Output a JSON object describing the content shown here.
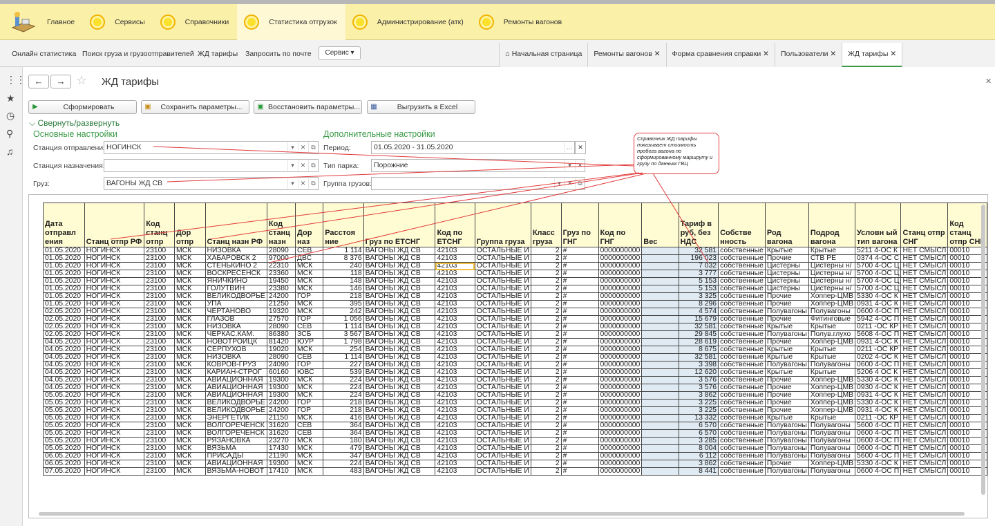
{
  "sections": [
    {
      "label": "Главное",
      "icon": "home-desk-icon"
    },
    {
      "label": "Сервисы",
      "icon": "circle-icon"
    },
    {
      "label": "Справочники",
      "icon": "circle-icon"
    },
    {
      "label": "Статистика отгрузок",
      "icon": "circle-icon"
    },
    {
      "label": "Администрирование (атк)",
      "icon": "circle-icon"
    },
    {
      "label": "Ремонты вагонов",
      "icon": "circle-icon"
    }
  ],
  "subnav": {
    "links": [
      "Онлайн статистика",
      "Поиск груза и грузоотправителей",
      "ЖД тарифы",
      "Запросить по почте"
    ],
    "service_button": "Сервис ▾"
  },
  "open_tabs": [
    {
      "label": "Начальная страница",
      "icon": "home-icon",
      "closable": false
    },
    {
      "label": "Ремонты вагонов",
      "closable": true
    },
    {
      "label": "Форма сравнения справки",
      "closable": true
    },
    {
      "label": "Пользователи",
      "closable": true
    },
    {
      "label": "ЖД тарифы",
      "closable": true
    }
  ],
  "form": {
    "title": "ЖД тарифы",
    "buttons": {
      "generate": "Сформировать",
      "save_params": "Сохранить параметры...",
      "restore_params": "Восстановить параметры...",
      "export_excel": "Выгрузить в Excel"
    },
    "collapse_label": "Свернуть/развернуть",
    "main_settings": "Основные настройки",
    "extra_settings": "Дополнительные настройки",
    "fields": {
      "departure_station": {
        "label": "Станция отправления:",
        "value": "НОГИНСК"
      },
      "destination_station": {
        "label": "Станция назначения:",
        "value": ""
      },
      "cargo": {
        "label": "Груз:",
        "value": "ВАГОНЫ ЖД СВ"
      },
      "period": {
        "label": "Период:",
        "value": "01.05.2020 - 31.05.2020"
      },
      "park_type": {
        "label": "Тип парка:",
        "value": "Порожние"
      },
      "cargo_group": {
        "label": "Группа грузов:",
        "value": ""
      }
    },
    "note": "Справочник ЖД тарифы показывает стоимость пробега вагона по сформированному маршруту и грузу по данным ГВЦ"
  },
  "table": {
    "headers": [
      "Дата отправл ения",
      "Станц отпр РФ",
      "Код станц отпр",
      "Дор отпр",
      "Станц назн РФ",
      "Код станц назн",
      "Дор наз",
      "Расстоя ние",
      "Груз по ЕТСНГ",
      "Код по ЕТСНГ",
      "Группа груза",
      "Класс груза",
      "Груз по ГНГ",
      "Код по ГНГ",
      "Вес",
      "Тариф в руб, без НДС",
      "Собстве нность",
      "Род вагона",
      "Подрод вагона",
      "Условн ый тип вагона",
      "Станц отпр СНГ",
      "Код станц отпр СНГ"
    ],
    "rows": [
      [
        "01.05.2020",
        "НОГИНСК",
        "23100",
        "МСК",
        "НИЗОВКА",
        "28090",
        "СЕВ",
        "1 114",
        "ВАГОНЫ ЖД СВ",
        "42103",
        "ОСТАЛЬНЫЕ И",
        "2",
        "#",
        "0000000000",
        "",
        "32 581",
        "собственные",
        "Крытые",
        "Крытые",
        "5211 4-ОС К",
        "НЕТ СМЫСЛ",
        "00010"
      ],
      [
        "01.05.2020",
        "НОГИНСК",
        "23100",
        "МСК",
        "ХАБАРОВСК 2",
        "97000",
        "ДВС",
        "8 376",
        "ВАГОНЫ ЖД СВ",
        "42103",
        "ОСТАЛЬНЫЕ И",
        "2",
        "#",
        "0000000000",
        "",
        "196 023",
        "собственные",
        "Прочие",
        "СТВ РЕ",
        "0374 4-ОС С",
        "НЕТ СМЫСЛ",
        "00010"
      ],
      [
        "01.05.2020",
        "НОГИНСК",
        "23100",
        "МСК",
        "СТЕНЬКИНО 2",
        "22310",
        "МСК",
        "240",
        "ВАГОНЫ ЖД СВ",
        "42103",
        "ОСТАЛЬНЫЕ И",
        "2",
        "#",
        "0000000000",
        "",
        "7 032",
        "собственные",
        "Цистерны",
        "Цистерны н/",
        "5700 4-ОС Ц",
        "НЕТ СМЫСЛ",
        "00010"
      ],
      [
        "01.05.2020",
        "НОГИНСК",
        "23100",
        "МСК",
        "ВОСКРЕСЕНСК",
        "23360",
        "МСК",
        "118",
        "ВАГОНЫ ЖД СВ",
        "42103",
        "ОСТАЛЬНЫЕ И",
        "2",
        "#",
        "0000000000",
        "",
        "3 777",
        "собственные",
        "Цистерны",
        "Цистерны н/",
        "5700 4-ОС Ц",
        "НЕТ СМЫСЛ",
        "00010"
      ],
      [
        "01.05.2020",
        "НОГИНСК",
        "23100",
        "МСК",
        "ЯНИЧКИНО",
        "19450",
        "МСК",
        "148",
        "ВАГОНЫ ЖД СВ",
        "42103",
        "ОСТАЛЬНЫЕ И",
        "2",
        "#",
        "0000000000",
        "",
        "5 153",
        "собственные",
        "Цистерны",
        "Цистерны н/",
        "5700 4-ОС Ц",
        "НЕТ СМЫСЛ",
        "00010"
      ],
      [
        "01.05.2020",
        "НОГИНСК",
        "23100",
        "МСК",
        "ГОЛУТВИН",
        "23380",
        "МСК",
        "146",
        "ВАГОНЫ ЖД СВ",
        "42103",
        "ОСТАЛЬНЫЕ И",
        "2",
        "#",
        "0000000000",
        "",
        "5 153",
        "собственные",
        "Цистерны",
        "Цистерны н/",
        "5700 4-ОС Ц",
        "НЕТ СМЫСЛ",
        "00010"
      ],
      [
        "01.05.2020",
        "НОГИНСК",
        "23100",
        "МСК",
        "ВЕЛИКОДВОРЬЕ",
        "24200",
        "ГОР",
        "218",
        "ВАГОНЫ ЖД СВ",
        "42103",
        "ОСТАЛЬНЫЕ И",
        "2",
        "#",
        "0000000000",
        "",
        "3 325",
        "собственные",
        "Прочие",
        "Хоппер-ЦМВ",
        "5330 4-ОС К",
        "НЕТ СМЫСЛ",
        "00010"
      ],
      [
        "01.05.2020",
        "НОГИНСК",
        "23100",
        "МСК",
        "УПА",
        "21250",
        "МСК",
        "395",
        "ВАГОНЫ ЖД СВ",
        "42103",
        "ОСТАЛЬНЫЕ И",
        "2",
        "#",
        "0000000000",
        "",
        "8 296",
        "собственные",
        "Прочие",
        "Хоппер-ЦМВ",
        "0931 4-ОС К",
        "НЕТ СМЫСЛ",
        "00010"
      ],
      [
        "02.05.2020",
        "НОГИНСК",
        "23100",
        "МСК",
        "ЧЕРТАНОВО",
        "19320",
        "МСК",
        "242",
        "ВАГОНЫ ЖД СВ",
        "42103",
        "ОСТАЛЬНЫЕ И",
        "2",
        "#",
        "0000000000",
        "",
        "4 574",
        "собственные",
        "Полувагоны",
        "Полувагоны",
        "0600 4-ОС П",
        "НЕТ СМЫСЛ",
        "00010"
      ],
      [
        "02.05.2020",
        "НОГИНСК",
        "23100",
        "МСК",
        "ГЛАЗОВ",
        "27570",
        "ГОР",
        "1 056",
        "ВАГОНЫ ЖД СВ",
        "42103",
        "ОСТАЛЬНЫЕ И",
        "2",
        "#",
        "0000000000",
        "",
        "15 679",
        "собственные",
        "Прочие",
        "Фитинговые",
        "5942 4-ОС П",
        "НЕТ СМЫСЛ",
        "00010"
      ],
      [
        "02.05.2020",
        "НОГИНСК",
        "23100",
        "МСК",
        "НИЗОВКА",
        "28090",
        "СЕВ",
        "1 114",
        "ВАГОНЫ ЖД СВ",
        "42103",
        "ОСТАЛЬНЫЕ И",
        "2",
        "#",
        "0000000000",
        "",
        "32 581",
        "собственные",
        "Крытые",
        "Крытые",
        "0211 -ОС КР",
        "НЕТ СМЫСЛ",
        "00010"
      ],
      [
        "02.05.2020",
        "НОГИНСК",
        "23100",
        "МСК",
        "ЧЕРКАС.КАМ.",
        "86380",
        "ЗСБ",
        "3 567",
        "ВАГОНЫ ЖД СВ",
        "42103",
        "ОСТАЛЬНЫЕ И",
        "2",
        "#",
        "0000000000",
        "",
        "29 845",
        "собственные",
        "Полувагоны",
        "Полув.глухо",
        "5608 4-ОС П",
        "НЕТ СМЫСЛ",
        "00010"
      ],
      [
        "04.05.2020",
        "НОГИНСК",
        "23100",
        "МСК",
        "НОВОТРОИЦК",
        "81420",
        "ЮУР",
        "1 798",
        "ВАГОНЫ ЖД СВ",
        "42103",
        "ОСТАЛЬНЫЕ И",
        "2",
        "#",
        "0000000000",
        "",
        "28 619",
        "собственные",
        "Прочие",
        "Хоппер-ЦМВ",
        "0931 4-ОС К",
        "НЕТ СМЫСЛ",
        "00010"
      ],
      [
        "04.05.2020",
        "НОГИНСК",
        "23100",
        "МСК",
        "СЕРПУХОВ",
        "19020",
        "МСК",
        "254",
        "ВАГОНЫ ЖД СВ",
        "42103",
        "ОСТАЛЬНЫЕ И",
        "2",
        "#",
        "0000000000",
        "",
        "8 675",
        "собственные",
        "Крытые",
        "Крытые",
        "0211 -ОС КР",
        "НЕТ СМЫСЛ",
        "00010"
      ],
      [
        "04.05.2020",
        "НОГИНСК",
        "23100",
        "МСК",
        "НИЗОВКА",
        "28090",
        "СЕВ",
        "1 114",
        "ВАГОНЫ ЖД СВ",
        "42103",
        "ОСТАЛЬНЫЕ И",
        "2",
        "#",
        "0000000000",
        "",
        "32 581",
        "собственные",
        "Крытые",
        "Крытые",
        "0202 4-ОС К",
        "НЕТ СМЫСЛ",
        "00010"
      ],
      [
        "04.05.2020",
        "НОГИНСК",
        "23100",
        "МСК",
        "КОВРОВ-ГРУЗ",
        "24090",
        "ГОР",
        "227",
        "ВАГОНЫ ЖД СВ",
        "42103",
        "ОСТАЛЬНЫЕ И",
        "2",
        "#",
        "0000000000",
        "",
        "3 398",
        "собственные",
        "Полувагоны",
        "Полувагоны",
        "0600 4-ОС П",
        "НЕТ СМЫСЛ",
        "00010"
      ],
      [
        "04.05.2020",
        "НОГИНСК",
        "23100",
        "МСК",
        "КАРИАН-СТРОГ",
        "60160",
        "ЮВС",
        "539",
        "ВАГОНЫ ЖД СВ",
        "42103",
        "ОСТАЛЬНЫЕ И",
        "2",
        "#",
        "0000000000",
        "",
        "12 620",
        "собственные",
        "Крытые",
        "Крытые",
        "5206 4 ОС К",
        "НЕТ СМЫСЛ",
        "00010"
      ],
      [
        "04.05.2020",
        "НОГИНСК",
        "23100",
        "МСК",
        "АВИАЦИОННАЯ",
        "19300",
        "МСК",
        "224",
        "ВАГОНЫ ЖД СВ",
        "42103",
        "ОСТАЛЬНЫЕ И",
        "2",
        "#",
        "0000000000",
        "",
        "3 576",
        "собственные",
        "Прочие",
        "Хоппер-ЦМВ",
        "5330 4-ОС К",
        "НЕТ СМЫСЛ",
        "00010"
      ],
      [
        "04.05.2020",
        "НОГИНСК",
        "23100",
        "МСК",
        "АВИАЦИОННАЯ",
        "19300",
        "МСК",
        "224",
        "ВАГОНЫ ЖД СВ",
        "42103",
        "ОСТАЛЬНЫЕ И",
        "2",
        "#",
        "0000000000",
        "",
        "3 576",
        "собственные",
        "Прочие",
        "Хоппер-ЦМВ",
        "0930 4-ОС К",
        "НЕТ СМЫСЛ",
        "00010"
      ],
      [
        "05.05.2020",
        "НОГИНСК",
        "23100",
        "МСК",
        "АВИАЦИОННАЯ",
        "19300",
        "МСК",
        "224",
        "ВАГОНЫ ЖД СВ",
        "42103",
        "ОСТАЛЬНЫЕ И",
        "2",
        "#",
        "0000000000",
        "",
        "3 862",
        "собственные",
        "Прочие",
        "Хоппер-ЦМВ",
        "0931 4-ОС К",
        "НЕТ СМЫСЛ",
        "00010"
      ],
      [
        "05.05.2020",
        "НОГИНСК",
        "23100",
        "МСК",
        "ВЕЛИКОДВОРЬЕ",
        "24200",
        "ГОР",
        "218",
        "ВАГОНЫ ЖД СВ",
        "42103",
        "ОСТАЛЬНЫЕ И",
        "2",
        "#",
        "0000000000",
        "",
        "3 225",
        "собственные",
        "Прочие",
        "Хоппер-ЦМВ",
        "5330 4-ОС К",
        "НЕТ СМЫСЛ",
        "00010"
      ],
      [
        "05.05.2020",
        "НОГИНСК",
        "23100",
        "МСК",
        "ВЕЛИКОДВОРЬЕ",
        "24200",
        "ГОР",
        "218",
        "ВАГОНЫ ЖД СВ",
        "42103",
        "ОСТАЛЬНЫЕ И",
        "2",
        "#",
        "0000000000",
        "",
        "3 225",
        "собственные",
        "Прочие",
        "Хоппер-ЦМВ",
        "0931 4-ОС К",
        "НЕТ СМЫСЛ",
        "00010"
      ],
      [
        "05.05.2020",
        "НОГИНСК",
        "23100",
        "МСК",
        "ЭНЕРГЕТИК",
        "21150",
        "МСК",
        "416",
        "ВАГОНЫ ЖД СВ",
        "42103",
        "ОСТАЛЬНЫЕ И",
        "2",
        "#",
        "0000000000",
        "",
        "13 332",
        "собственные",
        "Крытые",
        "Крытые",
        "0211 -ОС КР",
        "НЕТ СМЫСЛ",
        "00010"
      ],
      [
        "05.05.2020",
        "НОГИНСК",
        "23100",
        "МСК",
        "ВОЛГОРЕЧЕНСК",
        "31620",
        "СЕВ",
        "364",
        "ВАГОНЫ ЖД СВ",
        "42103",
        "ОСТАЛЬНЫЕ И",
        "2",
        "#",
        "0000000000",
        "",
        "6 570",
        "собственные",
        "Полувагоны",
        "Полувагоны",
        "5600 4-ОС П",
        "НЕТ СМЫСЛ",
        "00010"
      ],
      [
        "05.05.2020",
        "НОГИНСК",
        "23100",
        "МСК",
        "ВОЛГОРЕЧЕНСК",
        "31620",
        "СЕВ",
        "364",
        "ВАГОНЫ ЖД СВ",
        "42103",
        "ОСТАЛЬНЫЕ И",
        "2",
        "#",
        "0000000000",
        "",
        "6 570",
        "собственные",
        "Полувагоны",
        "Полувагоны",
        "0600 4-ОС П",
        "НЕТ СМЫСЛ",
        "00010"
      ],
      [
        "05.05.2020",
        "НОГИНСК",
        "23100",
        "МСК",
        "РЯЗАНОВКА",
        "23270",
        "МСК",
        "180",
        "ВАГОНЫ ЖД СВ",
        "42103",
        "ОСТАЛЬНЫЕ И",
        "2",
        "#",
        "0000000000",
        "",
        "3 285",
        "собственные",
        "Полувагоны",
        "Полувагоны",
        "0600 4-ОС П",
        "НЕТ СМЫСЛ",
        "00010"
      ],
      [
        "05.05.2020",
        "НОГИНСК",
        "23100",
        "МСК",
        "ВЯЗЬМА",
        "17430",
        "МСК",
        "479",
        "ВАГОНЫ ЖД СВ",
        "42103",
        "ОСТАЛЬНЫЕ И",
        "2",
        "#",
        "0000000000",
        "",
        "8 004",
        "собственные",
        "Полувагоны",
        "Полувагоны",
        "0600 4-ОС П",
        "НЕТ СМЫСЛ",
        "00010"
      ],
      [
        "06.05.2020",
        "НОГИНСК",
        "23100",
        "МСК",
        "ПРИСАДЫ",
        "21190",
        "МСК",
        "347",
        "ВАГОНЫ ЖД СВ",
        "42103",
        "ОСТАЛЬНЫЕ И",
        "2",
        "#",
        "0000000000",
        "",
        "6 112",
        "собственные",
        "Полувагоны",
        "Полувагоны",
        "5600 4-ОС П",
        "НЕТ СМЫСЛ",
        "00010"
      ],
      [
        "06.05.2020",
        "НОГИНСК",
        "23100",
        "МСК",
        "АВИАЦИОННАЯ",
        "19300",
        "МСК",
        "224",
        "ВАГОНЫ ЖД СВ",
        "42103",
        "ОСТАЛЬНЫЕ И",
        "2",
        "#",
        "0000000000",
        "",
        "3 862",
        "собственные",
        "Прочие",
        "Хоппер-ЦМВ",
        "5330 4-ОС К",
        "НЕТ СМЫСЛ",
        "00010"
      ],
      [
        "07.05.2020",
        "НОГИНСК",
        "23100",
        "МСК",
        "ВЯЗЬМА-НОВОТ",
        "17410",
        "МСК",
        "483",
        "ВАГОНЫ ЖД СВ",
        "42103",
        "ОСТАЛЬНЫЕ И",
        "2",
        "#",
        "0000000000",
        "",
        "8 441",
        "собственные",
        "Полувагоны",
        "Полувагоны",
        "0600 4-ОС П",
        "НЕТ СМЫСЛ",
        "00010"
      ]
    ]
  },
  "colors": {
    "accent_green": "#3c9b49",
    "section_bar": "#fbf0a8",
    "header_cell": "#fffbd3",
    "annotation_red": "#e23a3a"
  }
}
